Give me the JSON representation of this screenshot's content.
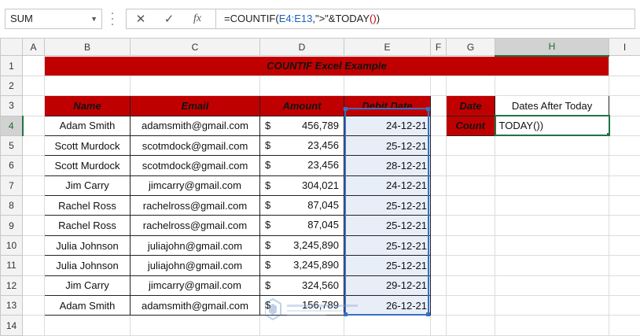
{
  "namebox": {
    "value": "SUM"
  },
  "formula_bar": {
    "prefix": "=COUNTIF(",
    "ref": "E4:E13",
    "mid": ",\">\"&TODAY",
    "open_paren": "(",
    "close_paren": ")",
    "suffix": ")"
  },
  "columns": [
    "A",
    "B",
    "C",
    "D",
    "E",
    "F",
    "G",
    "H",
    "I"
  ],
  "rows": [
    "1",
    "2",
    "3",
    "4",
    "5",
    "6",
    "7",
    "8",
    "9",
    "10",
    "11",
    "12",
    "13",
    "14"
  ],
  "title": "COUNTIF Excel Example",
  "table": {
    "headers": {
      "name": "Name",
      "email": "Email",
      "amount": "Amount",
      "date": "Debit Date"
    },
    "currency": "$",
    "records": [
      {
        "name": "Adam Smith",
        "email": "adamsmith@gmail.com",
        "amount": "456,789",
        "date": "24-12-21"
      },
      {
        "name": "Scott Murdock",
        "email": "scotmdock@gmail.com",
        "amount": "23,456",
        "date": "25-12-21"
      },
      {
        "name": "Scott Murdock",
        "email": "scotmdock@gmail.com",
        "amount": "23,456",
        "date": "28-12-21"
      },
      {
        "name": "Jim Carry",
        "email": "jimcarry@gmail.com",
        "amount": "304,021",
        "date": "24-12-21"
      },
      {
        "name": "Rachel Ross",
        "email": "rachelross@gmail.com",
        "amount": "87,045",
        "date": "25-12-21"
      },
      {
        "name": "Rachel Ross",
        "email": "rachelross@gmail.com",
        "amount": "87,045",
        "date": "25-12-21"
      },
      {
        "name": "Julia Johnson",
        "email": "juliajohn@gmail.com",
        "amount": "3,245,890",
        "date": "25-12-21"
      },
      {
        "name": "Julia Johnson",
        "email": "juliajohn@gmail.com",
        "amount": "3,245,890",
        "date": "25-12-21"
      },
      {
        "name": "Jim Carry",
        "email": "jimcarry@gmail.com",
        "amount": "324,560",
        "date": "29-12-21"
      },
      {
        "name": "Adam Smith",
        "email": "adamsmith@gmail.com",
        "amount": "156,789",
        "date": "26-12-21"
      }
    ]
  },
  "side": {
    "label1": "Date",
    "label2": "Count",
    "header": "Dates After Today",
    "active_cell": "TODAY())"
  },
  "colors": {
    "accent_red": "#c00000",
    "excel_green": "#217346",
    "range_blue": "#3a6fc4"
  }
}
